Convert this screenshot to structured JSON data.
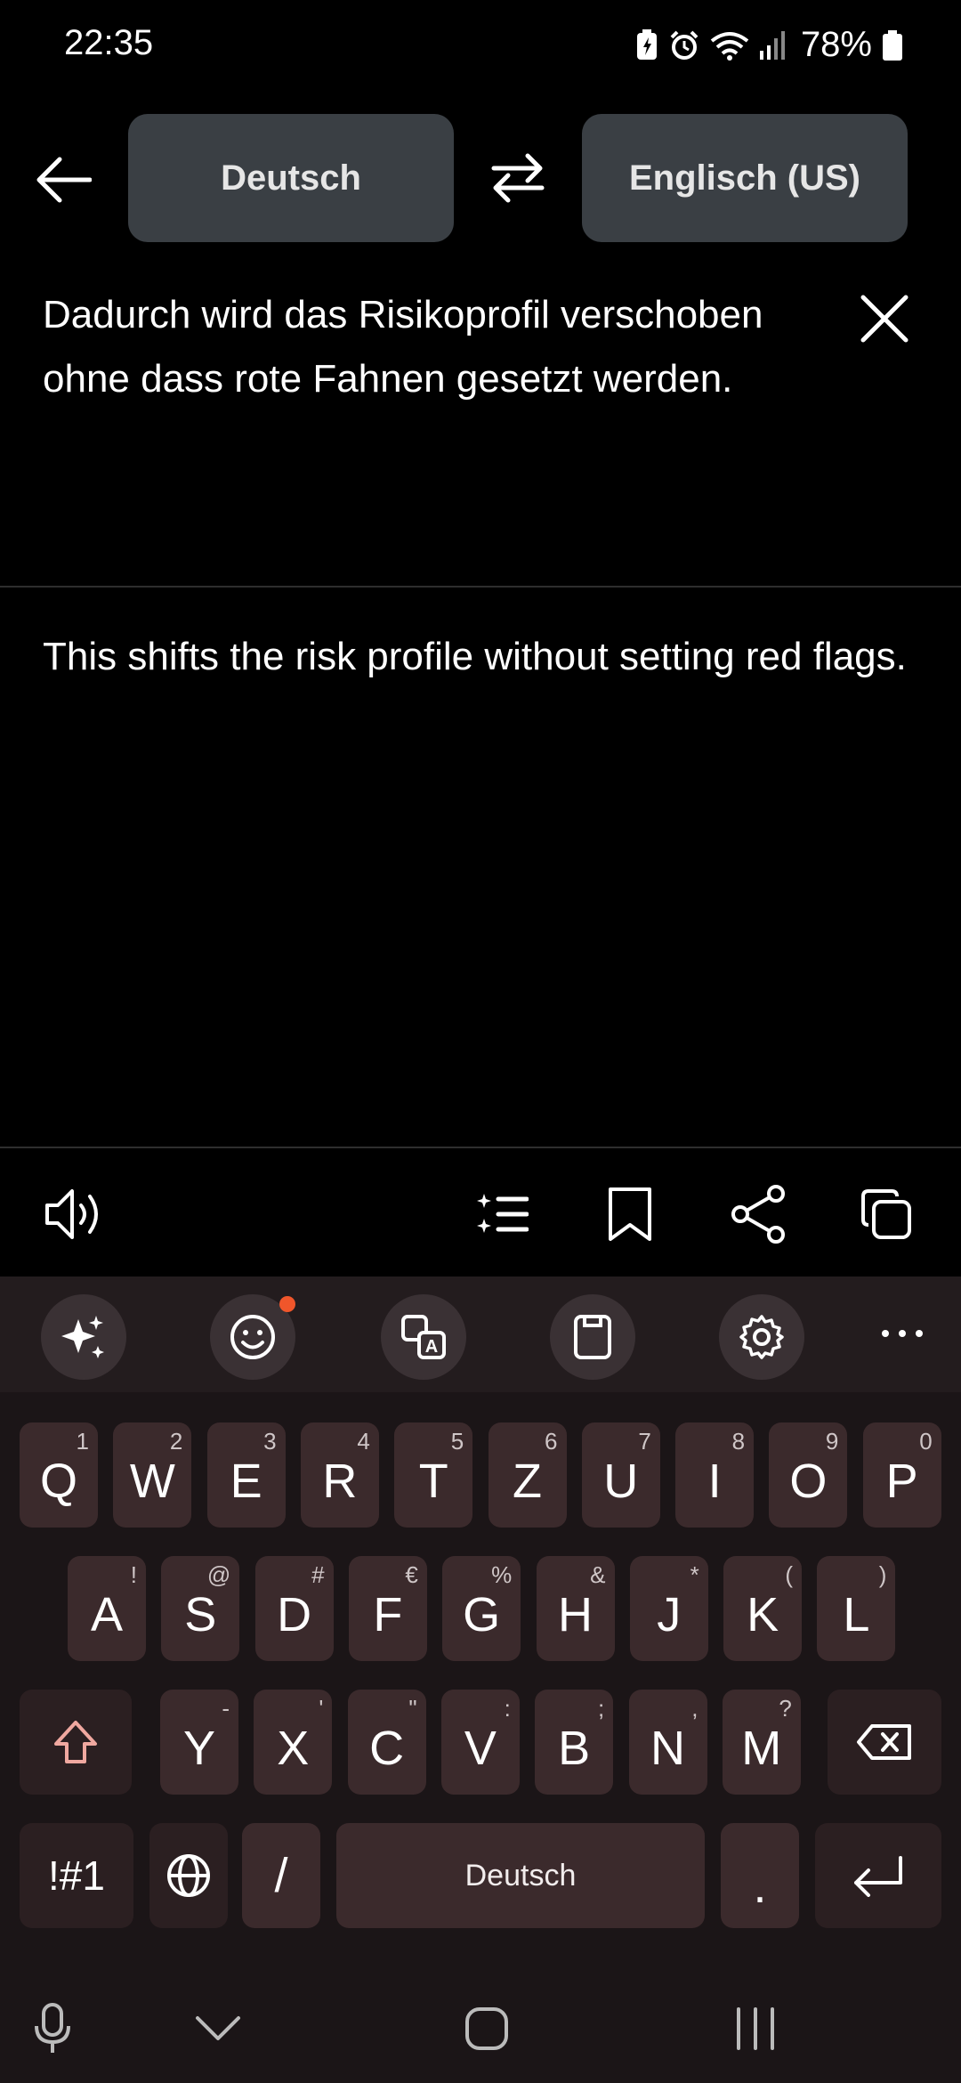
{
  "status": {
    "time": "22:35",
    "battery": "78%"
  },
  "languages": {
    "source": "Deutsch",
    "target": "Englisch (US)"
  },
  "source_text": "Dadurch wird das Risikoprofil verschoben ohne dass rote Fahnen gesetzt werden.",
  "translated_text": "This shifts the risk profile without setting red flags.",
  "keyboard": {
    "row1": [
      {
        "k": "Q",
        "h": "1"
      },
      {
        "k": "W",
        "h": "2"
      },
      {
        "k": "E",
        "h": "3"
      },
      {
        "k": "R",
        "h": "4"
      },
      {
        "k": "T",
        "h": "5"
      },
      {
        "k": "Z",
        "h": "6"
      },
      {
        "k": "U",
        "h": "7"
      },
      {
        "k": "I",
        "h": "8"
      },
      {
        "k": "O",
        "h": "9"
      },
      {
        "k": "P",
        "h": "0"
      }
    ],
    "row2": [
      {
        "k": "A",
        "h": "!"
      },
      {
        "k": "S",
        "h": "@"
      },
      {
        "k": "D",
        "h": "#"
      },
      {
        "k": "F",
        "h": "€"
      },
      {
        "k": "G",
        "h": "%"
      },
      {
        "k": "H",
        "h": "&"
      },
      {
        "k": "J",
        "h": "*"
      },
      {
        "k": "K",
        "h": "("
      },
      {
        "k": "L",
        "h": ")"
      }
    ],
    "row3": [
      {
        "k": "Y",
        "h": "-"
      },
      {
        "k": "X",
        "h": "'"
      },
      {
        "k": "C",
        "h": "\""
      },
      {
        "k": "V",
        "h": ":"
      },
      {
        "k": "B",
        "h": ";"
      },
      {
        "k": "N",
        "h": ","
      },
      {
        "k": "M",
        "h": "?"
      }
    ],
    "symbols_label": "!#1",
    "slash_label": "/",
    "space_label": "Deutsch",
    "period_label": "."
  }
}
